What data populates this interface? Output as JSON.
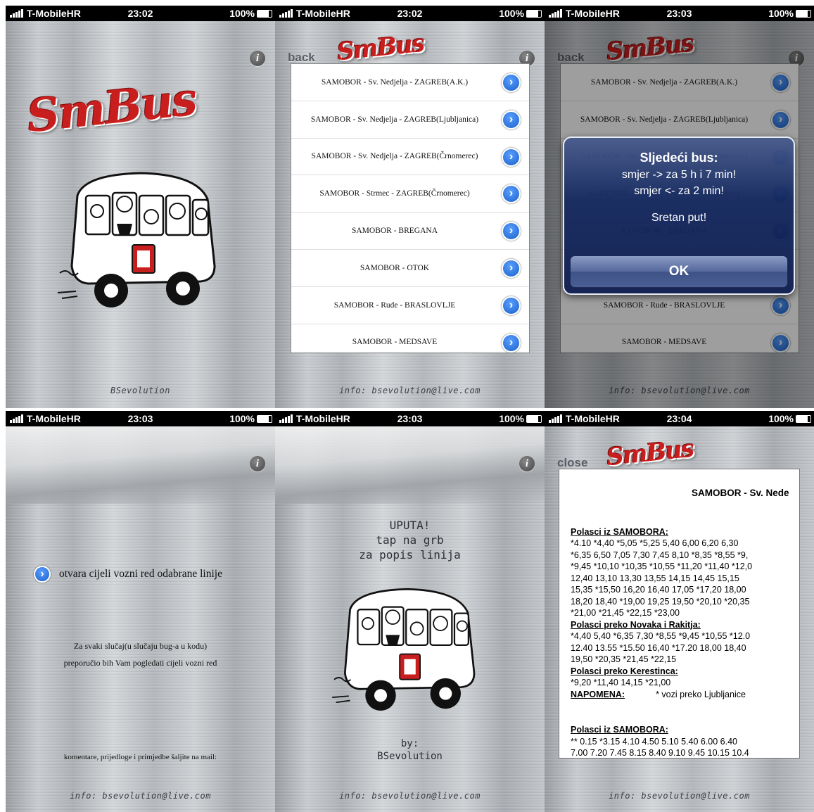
{
  "status": {
    "carrier": "T-MobileHR",
    "battery": "100%",
    "times": [
      "23:02",
      "23:02",
      "23:03",
      "23:03",
      "23:03",
      "23:04"
    ]
  },
  "app": {
    "logo_text": "SmBus",
    "info_glyph": "i"
  },
  "screen1": {
    "footer": "BSevolution"
  },
  "screen2": {
    "back_label": "back",
    "footer": "info: bsevolution@live.com",
    "routes": [
      "SAMOBOR - Sv. Nedjelja - ZAGREB(A.K.)",
      "SAMOBOR - Sv. Nedjelja - ZAGREB(Ljubljanica)",
      "SAMOBOR - Sv. Nedjelja - ZAGREB(Črnomerec)",
      "SAMOBOR - Strmec - ZAGREB(Črnomerec)",
      "SAMOBOR - BREGANA",
      "SAMOBOR - OTOK",
      "SAMOBOR - Rude - BRASLOVLJE",
      "SAMOBOR - MEDSAVE"
    ]
  },
  "screen3": {
    "back_label": "back",
    "footer": "info: bsevolution@live.com",
    "alert": {
      "title": "Sljedeći bus:",
      "line1": "smjer -> za 5 h i 7 min!",
      "line2": "smjer <- za 2 min!",
      "line3": "Sretan put!",
      "ok": "OK"
    }
  },
  "screen4": {
    "hint": "otvara cijeli vozni red odabrane linije",
    "note_line1": "Za svaki slučaj(u slučaju bug-a u kodu)",
    "note_line2": "preporučio bih Vam pogledati cijeli vozni red",
    "mail_note": "komentare, prijedloge i primjedbe šaljite na mail:",
    "footer": "info: bsevolution@live.com"
  },
  "screen5": {
    "uputa1": "UPUTA!",
    "uputa2": "tap na grb",
    "uputa3": "za popis linija",
    "by": "by:",
    "author": "BSevolution",
    "footer": "info: bsevolution@live.com"
  },
  "screen6": {
    "close_label": "close",
    "footer": "info: bsevolution@live.com",
    "title": "SAMOBOR - Sv. Nede",
    "h1": "Polasci iz SAMOBORA:",
    "l1": "*4.10 *4,40 *5,05 *5,25 5,40 6,00 6,20 6,30",
    "l2": "*6,35 6,50 7,05 7,30 7,45 8,10 *8,35 *8,55 *9,",
    "l3": "*9,45 *10,10 *10,35 *10,55 *11,20 *11,40 *12,0",
    "l4": "12,40 13,10 13,30 13,55 14,15 14,45 15,15",
    "l5": "15,35 *15,50 16,20 16,40 17,05 *17,20 18,00",
    "l6": "18,20 18,40 *19,00 19,25 19,50 *20,10 *20,35",
    "l7": "*21,00 *21,45 *22,15 *23,00",
    "h2": "Polasci preko Novaka i Rakitja:",
    "l8": "*4,40 5,40 *6,35 7,30 *8,55 *9,45 *10,55 *12.0",
    "l9": "12.40 13.55 *15.50 16,40 *17.20 18,00 18,40",
    "l10": "19,50 *20,35 *21,45 *22,15",
    "h3": "Polasci preko Kerestinca:",
    "l11": "*9,20 *11,40 14,15 *21,00",
    "napomena_label": "NAPOMENA:",
    "napomena_text": "* vozi preko Ljubljanice",
    "h4": "Polasci iz SAMOBORA:",
    "l12": "** 0.15 *3.15 4.10 4.50 5.10 5.40 6.00 6.40",
    "l13": "7.00 7.20 7.45 8.15 8.40 9.10 9.45 10.15 10.4"
  }
}
